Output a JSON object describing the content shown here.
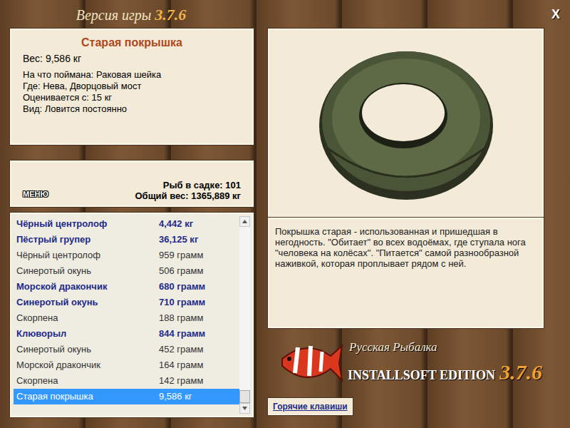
{
  "window": {
    "title": "Версия игры",
    "version": "3.7.6",
    "close": "X"
  },
  "item": {
    "name": "Старая покрышка",
    "weight": "Вес: 9,586 кг",
    "details": [
      "На что поймана: Раковая шейка",
      "Где: Нева, Дворцовый мост",
      "Оценивается с: 15 кг",
      "Вид: Ловится постоянно"
    ]
  },
  "stats": {
    "menu": "МЕНЮ",
    "count": "Рыб в садке: 101",
    "total": "Общий вес: 1365,889 кг"
  },
  "catch_list": {
    "scroll": 1,
    "rows": [
      {
        "name": "Чёрный центролоф",
        "weight": "4,442 кг",
        "highlighted": true,
        "selected": false
      },
      {
        "name": "Пёстрый групер",
        "weight": "36,125 кг",
        "highlighted": true,
        "selected": false
      },
      {
        "name": "Чёрный центролоф",
        "weight": "959 грамм",
        "highlighted": false,
        "selected": false
      },
      {
        "name": "Синеротый окунь",
        "weight": "506 грамм",
        "highlighted": false,
        "selected": false
      },
      {
        "name": "Морской дракончик",
        "weight": "680 грамм",
        "highlighted": true,
        "selected": false
      },
      {
        "name": "Синеротый окунь",
        "weight": "710 грамм",
        "highlighted": true,
        "selected": false
      },
      {
        "name": "Скорпена",
        "weight": "188 грамм",
        "highlighted": false,
        "selected": false
      },
      {
        "name": "Клюворыл",
        "weight": "844 грамм",
        "highlighted": true,
        "selected": false
      },
      {
        "name": "Синеротый окунь",
        "weight": "452 грамм",
        "highlighted": false,
        "selected": false
      },
      {
        "name": "Морской дракончик",
        "weight": "164 грамм",
        "highlighted": false,
        "selected": false
      },
      {
        "name": "Скорпена",
        "weight": "142 грамм",
        "highlighted": false,
        "selected": false
      },
      {
        "name": "Старая покрышка",
        "weight": "9,586 кг",
        "highlighted": false,
        "selected": true
      }
    ]
  },
  "description": "Покрышка старая - использованная и пришедшая в негодность. \"Обитает\" во всех водоёмах, где ступала нога \"человека на колёсах\". \"Питается\" самой разнообразной наживкой, которая проплывает рядом с ней.",
  "logo": {
    "title": "Русская Рыбалка",
    "edition": "INSTALLSOFT EDITION",
    "version": "3.7.6"
  },
  "hotkeys_button": "Горячие клавиши"
}
